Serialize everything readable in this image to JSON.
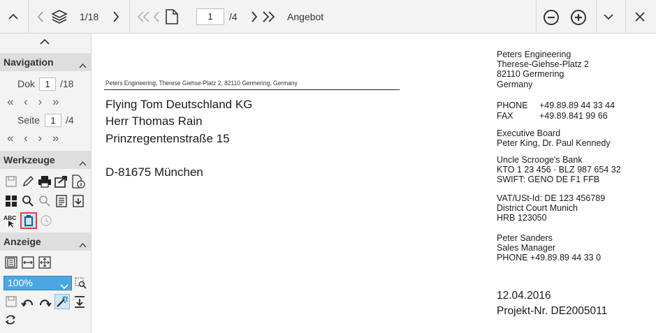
{
  "toolbar": {
    "doc_counter": "1/18",
    "page_input": "1",
    "page_total": "/4",
    "doc_type": "Angebot"
  },
  "sidebar": {
    "navigation": {
      "title": "Navigation",
      "dok_label": "Dok",
      "dok_value": "1",
      "dok_total": "/18",
      "seite_label": "Seite",
      "seite_value": "1",
      "seite_total": "/4",
      "arrows": "« ‹ › »"
    },
    "werkzeuge": {
      "title": "Werkzeuge",
      "abc_label": "ABC"
    },
    "anzeige": {
      "title": "Anzeige",
      "zoom_value": "100%"
    }
  },
  "document": {
    "sender_line": "Peters Engineering, Therese Giehse-Platz 2, 82110 Germering, Germany",
    "recipient": [
      "Flying Tom Deutschland KG",
      "Herr Thomas Rain",
      "Prinzregentenstraße 15"
    ],
    "city": "D-81675 München",
    "company_block": [
      "Peters Engineering",
      "Therese-Giehse-Platz 2",
      "82110 Germering",
      "Germany"
    ],
    "phone_label": "PHONE",
    "phone_value": "+49.89.89 44 33 44",
    "fax_label": "FAX",
    "fax_value": "+49.89.841 99 66",
    "board_block": [
      "Executive Board",
      "Peter King, Dr. Paul Kennedy"
    ],
    "bank_block": [
      "Uncle Scrooge's Bank",
      "KTO 1 23 456 · BLZ 987 654 32",
      "SWIFT: GENO DE F1 FFB"
    ],
    "vat_block": [
      "VAT/USt-Id: DE 123 456789",
      "District Court Munich",
      "HRB 123050"
    ],
    "contact_block": [
      "Peter Sanders",
      "Sales Manager",
      "PHONE +49.89.89 44 33 0"
    ],
    "date": "12.04.2016",
    "project": "Projekt-Nr. DE2005011"
  }
}
